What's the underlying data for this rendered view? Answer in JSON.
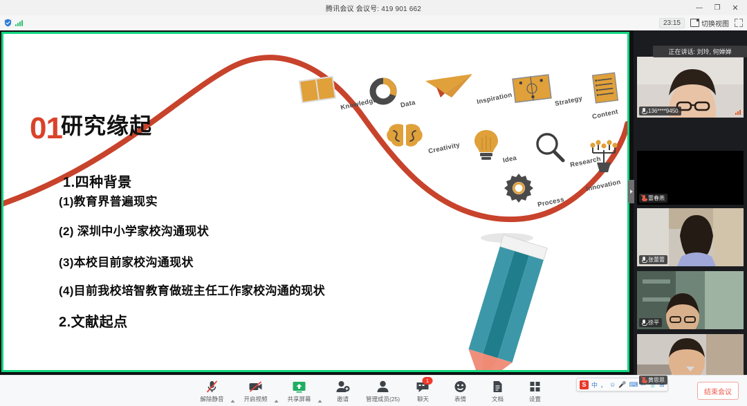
{
  "window": {
    "title": "腾讯会议 会议号: 419 901 662",
    "minimize": "—",
    "maximize": "❐",
    "close": "✕"
  },
  "statusbar": {
    "shield_icon": "shield-icon",
    "signal_icon": "signal-strength-icon",
    "timer": "23:15",
    "view_switch_label": "切换视图",
    "fullscreen_icon": "fullscreen-icon"
  },
  "slide": {
    "number": "01",
    "title": "研究缘起",
    "bullets": [
      "1.四种背景",
      "(1)教育界普遍现实",
      "(2) 深圳中小学家校沟通现状",
      "(3)本校目前家校沟通现状",
      "(4)目前我校培智教育做班主任工作家校沟通的现状",
      "2.文献起点"
    ],
    "mindmap_icons": [
      {
        "name": "Knowledge",
        "icon": "book-icon"
      },
      {
        "name": "Data",
        "icon": "donut-chart-icon"
      },
      {
        "name": "Inspiration",
        "icon": "paper-plane-icon"
      },
      {
        "name": "Strategy",
        "icon": "playbook-icon"
      },
      {
        "name": "Content",
        "icon": "list-document-icon"
      },
      {
        "name": "Creativity",
        "icon": "brain-icon"
      },
      {
        "name": "Idea",
        "icon": "lightbulb-icon"
      },
      {
        "name": "Research",
        "icon": "magnifier-icon"
      },
      {
        "name": "Innovation",
        "icon": "idea-tree-icon"
      },
      {
        "name": "Process",
        "icon": "gear-icon"
      }
    ],
    "colors": {
      "accent_red": "#d9422b",
      "icon_orange": "#e0a03a",
      "pencil_teal": "#2b8a9c",
      "pencil_tip": "#f0907c",
      "share_border_green": "#10d67e"
    }
  },
  "panel": {
    "speaking_label": "正在讲话: 刘玲, 何婵婵",
    "participants": [
      {
        "name": "136****9450",
        "muted": false,
        "video_on": true,
        "speaking": true
      },
      {
        "name": "雷春燕",
        "muted": true,
        "video_on": false,
        "speaking": false
      },
      {
        "name": "张蕾蕾",
        "muted": false,
        "video_on": true,
        "speaking": false
      },
      {
        "name": "徐平",
        "muted": false,
        "video_on": true,
        "speaking": false
      },
      {
        "name": "黄思思",
        "muted": true,
        "video_on": true,
        "speaking": false
      }
    ],
    "scroll_down_icon": "chevron-down-icon",
    "collapse_icon": "chevron-right-icon"
  },
  "toolbar": {
    "items": [
      {
        "label": "解除静音",
        "icon": "microphone-muted-icon",
        "caret": true,
        "badge": ""
      },
      {
        "label": "开启视频",
        "icon": "camera-off-icon",
        "caret": true,
        "badge": ""
      },
      {
        "label": "共享屏幕",
        "icon": "screen-share-icon",
        "caret": true,
        "badge": ""
      },
      {
        "label": "邀请",
        "icon": "invite-user-icon",
        "caret": false,
        "badge": ""
      },
      {
        "label": "管理成员(25)",
        "icon": "manage-members-icon",
        "caret": false,
        "badge": ""
      },
      {
        "label": "聊天",
        "icon": "chat-bubble-icon",
        "caret": false,
        "badge": "1"
      },
      {
        "label": "表情",
        "icon": "emoji-icon",
        "caret": false,
        "badge": ""
      },
      {
        "label": "文档",
        "icon": "document-icon",
        "caret": false,
        "badge": ""
      },
      {
        "label": "设置",
        "icon": "settings-grid-icon",
        "caret": false,
        "badge": ""
      }
    ],
    "end_meeting_label": "结束会议"
  },
  "ime": {
    "logo": "S",
    "items": [
      "中",
      "，",
      "☺",
      "🎤",
      "⌨",
      "✂",
      "👕",
      "⊞"
    ]
  }
}
